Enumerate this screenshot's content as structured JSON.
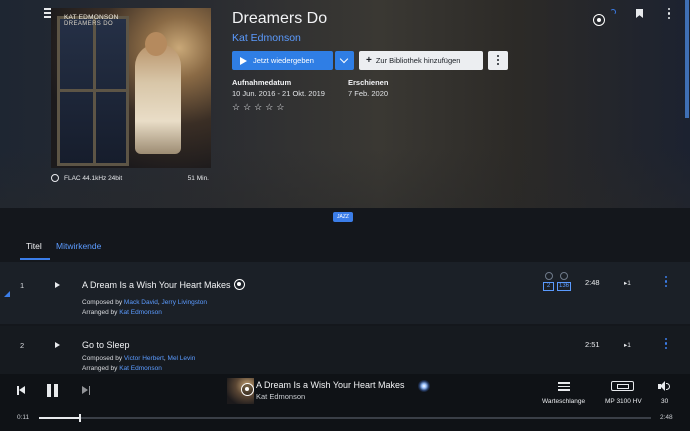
{
  "album": {
    "title": "Dreamers Do",
    "artist": "Kat Edmonson",
    "cover_artist": "KAT EDMONSON",
    "cover_title": "DREAMERS DO",
    "quality": "FLAC 44.1kHz 24bit",
    "duration": "51 Min.",
    "recording_label": "Aufnahmedatum",
    "recording_value": "10 Jun. 2016 - 21 Okt. 2019",
    "release_label": "Erschienen",
    "release_value": "7 Feb. 2020",
    "rating_stars": [
      "☆",
      "☆",
      "☆",
      "☆",
      "☆"
    ],
    "genre": "JAZZ"
  },
  "actions": {
    "play_label": "Jetzt wiedergeben",
    "library_label": "Zur Bibliothek hinzufügen"
  },
  "tabs": [
    {
      "label": "Titel",
      "active": true
    },
    {
      "label": "Mitwirkende",
      "active": false
    }
  ],
  "tracks": [
    {
      "number": "1",
      "title": "A Dream Is a Wish Your Heart Makes",
      "composed_prefix": "Composed by ",
      "composers": [
        "Mack David",
        "Jerry Livingston"
      ],
      "arranged_prefix": "Arranged by ",
      "arranger": "Kat Edmonson",
      "duration": "2:48",
      "next_label": "▸1",
      "badge_a": "2",
      "badge_b": "136"
    },
    {
      "number": "2",
      "title": "Go to Sleep",
      "composed_prefix": "Composed by ",
      "composers": [
        "Victor Herbert",
        "Mel Levin"
      ],
      "arranged_prefix": "Arranged by ",
      "arranger": "Kat Edmonson",
      "duration": "2:51",
      "next_label": "▸1"
    }
  ],
  "player": {
    "title": "A Dream Is a Wish Your Heart Makes",
    "artist": "Kat Edmonson",
    "queue_label": "Warteschlange",
    "device_label": "MP 3100 HV",
    "volume": "30",
    "time_current": "0:11",
    "time_total": "2:48",
    "progress_fraction": 0.065
  },
  "colors": {
    "accent": "#3b7de8",
    "link": "#5b9bff",
    "background": "#14171c"
  }
}
